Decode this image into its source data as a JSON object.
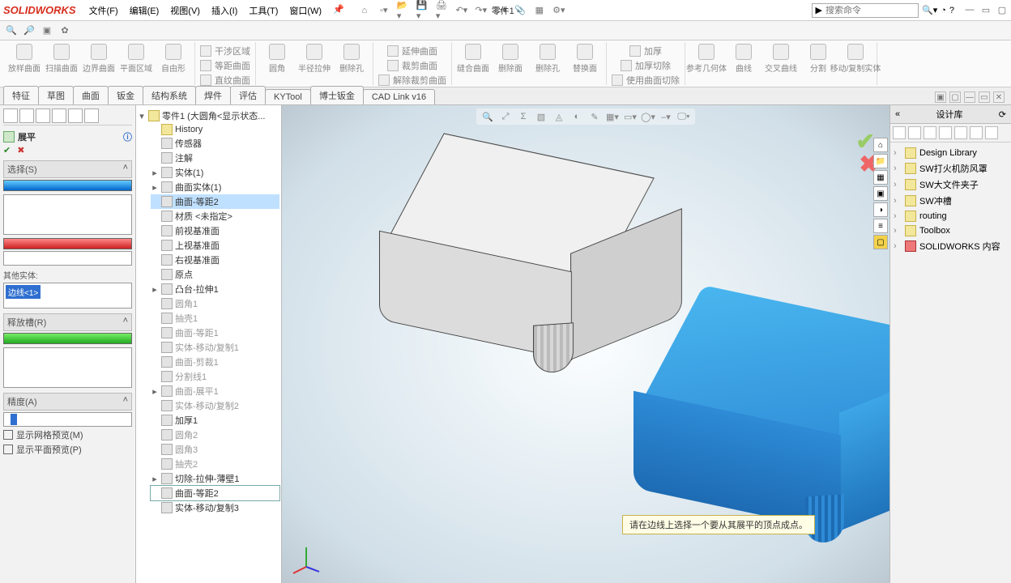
{
  "app": {
    "brand": "SOLIDWORKS",
    "doc_title": "零件1 -"
  },
  "menus": [
    "文件(F)",
    "编辑(E)",
    "视图(V)",
    "插入(I)",
    "工具(T)",
    "窗口(W)"
  ],
  "search": {
    "placeholder": "搜索命令"
  },
  "ribbon": {
    "g1": [
      "放样曲面",
      "扫描曲面",
      "边界曲面",
      "平面区域",
      "自由形"
    ],
    "g2": {
      "rows": [
        "干涉区域",
        "等距曲面",
        "直纹曲面"
      ],
      "btns": [
        "圆角",
        "半径拉伸",
        "删除孔"
      ]
    },
    "g3": [
      "延伸曲面",
      "裁剪曲面",
      "解除裁剪曲面"
    ],
    "g4": [
      "缝合曲面",
      "删除面",
      "删除孔",
      "替换面"
    ],
    "g5": {
      "rows": [
        "加厚",
        "加厚切除",
        "使用曲面切除"
      ]
    },
    "g6": [
      "参考几何体",
      "曲线",
      "交叉曲线",
      "分割",
      "移动/复制实体"
    ]
  },
  "tabs": [
    "特征",
    "草图",
    "曲面",
    "钣金",
    "结构系统",
    "焊件",
    "评估",
    "KYTool",
    "博士钣金",
    "CAD Link v16"
  ],
  "prop": {
    "title": "展平",
    "sect_select": "选择(S)",
    "other_bodies": "其他实体:",
    "selected_edge": "边线<1>",
    "sect_relief": "释放槽(R)",
    "sect_accuracy": "精度(A)",
    "chk_mesh": "显示网格预览(M)",
    "chk_plane": "显示平面预览(P)"
  },
  "tree": {
    "root": "零件1 (大圆角<显示状态...",
    "items": [
      "History",
      "传感器",
      "注解",
      "实体(1)",
      "曲面实体(1)",
      "曲面-等距2",
      "材质 <未指定>",
      "前视基准面",
      "上视基准面",
      "右视基准面",
      "原点",
      "凸台-拉伸1",
      "圆角1",
      "抽壳1",
      "曲面-等距1",
      "实体-移动/复制1",
      "曲面-剪裁1",
      "分割线1",
      "曲面-展平1",
      "实体-移动/复制2",
      "加厚1",
      "圆角2",
      "圆角3",
      "抽壳2",
      "切除-拉伸-薄壁1",
      "曲面-等距2",
      "实体-移动/复制3"
    ],
    "selected_index": 5,
    "highlight_last": 25
  },
  "viewport": {
    "hint": "请在边线上选择一个要从其展平的顶点成点。"
  },
  "dlib": {
    "title": "设计库",
    "items": [
      "Design Library",
      "SW打火机防风罩",
      "SW大文件夹子",
      "SW冲槽",
      "routing",
      "Toolbox",
      "SOLIDWORKS 内容"
    ]
  }
}
